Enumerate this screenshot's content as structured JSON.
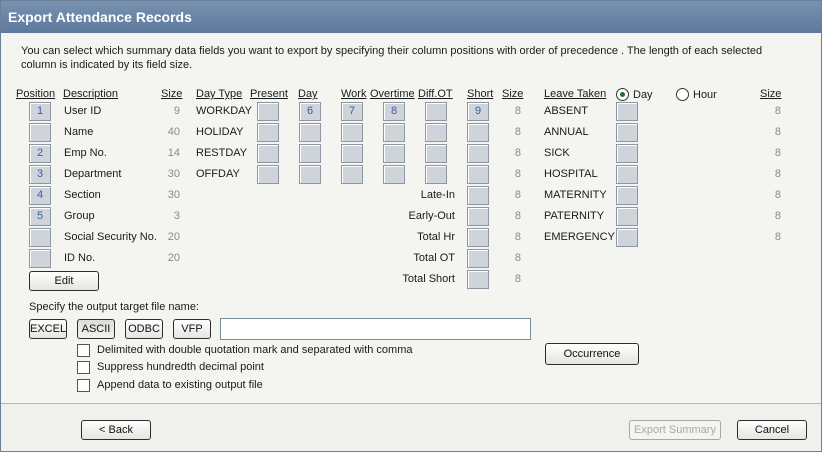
{
  "window": {
    "title": "Export Attendance Records"
  },
  "instructions": "You can select which summary data fields you want to export by specifying their column positions with order of  precedence . The length of each selected column is indicated by its field size.",
  "headers": {
    "position": "Position",
    "description": "Description",
    "size": "Size",
    "day_type": "Day Type",
    "present": "Present",
    "day": "Day",
    "work": "Work",
    "overtime": "Overtime",
    "diff_ot": "Diff.OT",
    "short": "Short",
    "size2": "Size",
    "leave_taken": "Leave Taken",
    "size3": "Size"
  },
  "fields": [
    {
      "position": "1",
      "description": "User ID",
      "size": "9"
    },
    {
      "position": "",
      "description": "Name",
      "size": "40"
    },
    {
      "position": "2",
      "description": "Emp No.",
      "size": "14"
    },
    {
      "position": "3",
      "description": "Department",
      "size": "30"
    },
    {
      "position": "4",
      "description": "Section",
      "size": "30"
    },
    {
      "position": "5",
      "description": "Group",
      "size": "3"
    },
    {
      "position": "",
      "description": "Social Security No.",
      "size": "20"
    },
    {
      "position": "",
      "description": "ID No.",
      "size": "20"
    }
  ],
  "day_types": [
    {
      "label": "WORKDAY",
      "present": "",
      "day": "6",
      "work": "7",
      "overtime": "8",
      "diff_ot": "",
      "short": "9",
      "size": "8"
    },
    {
      "label": "HOLIDAY",
      "present": "",
      "day": "",
      "work": "",
      "overtime": "",
      "diff_ot": "",
      "short": "",
      "size": "8"
    },
    {
      "label": "RESTDAY",
      "present": "",
      "day": "",
      "work": "",
      "overtime": "",
      "diff_ot": "",
      "short": "",
      "size": "8"
    },
    {
      "label": "OFFDAY",
      "present": "",
      "day": "",
      "work": "",
      "overtime": "",
      "diff_ot": "",
      "short": "",
      "size": "8"
    }
  ],
  "extra_rows": [
    {
      "label": "Late-In",
      "value": "",
      "size": "8"
    },
    {
      "label": "Early-Out",
      "value": "",
      "size": "8"
    },
    {
      "label": "Total Hr",
      "value": "",
      "size": "8"
    },
    {
      "label": "Total OT",
      "value": "",
      "size": "8"
    },
    {
      "label": "Total Short",
      "value": "",
      "size": "8"
    }
  ],
  "leave": {
    "radio_day": "Day",
    "radio_hour": "Hour",
    "selected": "Day",
    "items": [
      {
        "label": "ABSENT",
        "value": "",
        "size": "8"
      },
      {
        "label": "ANNUAL",
        "value": "",
        "size": "8"
      },
      {
        "label": "SICK",
        "value": "",
        "size": "8"
      },
      {
        "label": "HOSPITAL",
        "value": "",
        "size": "8"
      },
      {
        "label": "MATERNITY",
        "value": "",
        "size": "8"
      },
      {
        "label": "PATERNITY",
        "value": "",
        "size": "8"
      },
      {
        "label": "EMERGENCY",
        "value": "",
        "size": "8"
      }
    ]
  },
  "edit_button": "Edit",
  "output": {
    "label": "Specify the output target file name:",
    "formats": [
      "EXCEL",
      "ASCII",
      "ODBC",
      "VFP"
    ],
    "selected_format": "ASCII",
    "filename": "",
    "options": [
      {
        "label": "Delimited with double quotation mark and separated with comma",
        "checked": false
      },
      {
        "label": "Suppress hundredth decimal point",
        "checked": false
      },
      {
        "label": "Append data to existing output file",
        "checked": false
      }
    ],
    "occurrence_button": "Occurrence"
  },
  "footer": {
    "back": "< Back",
    "export_summary": "Export Summary",
    "cancel": "Cancel"
  }
}
